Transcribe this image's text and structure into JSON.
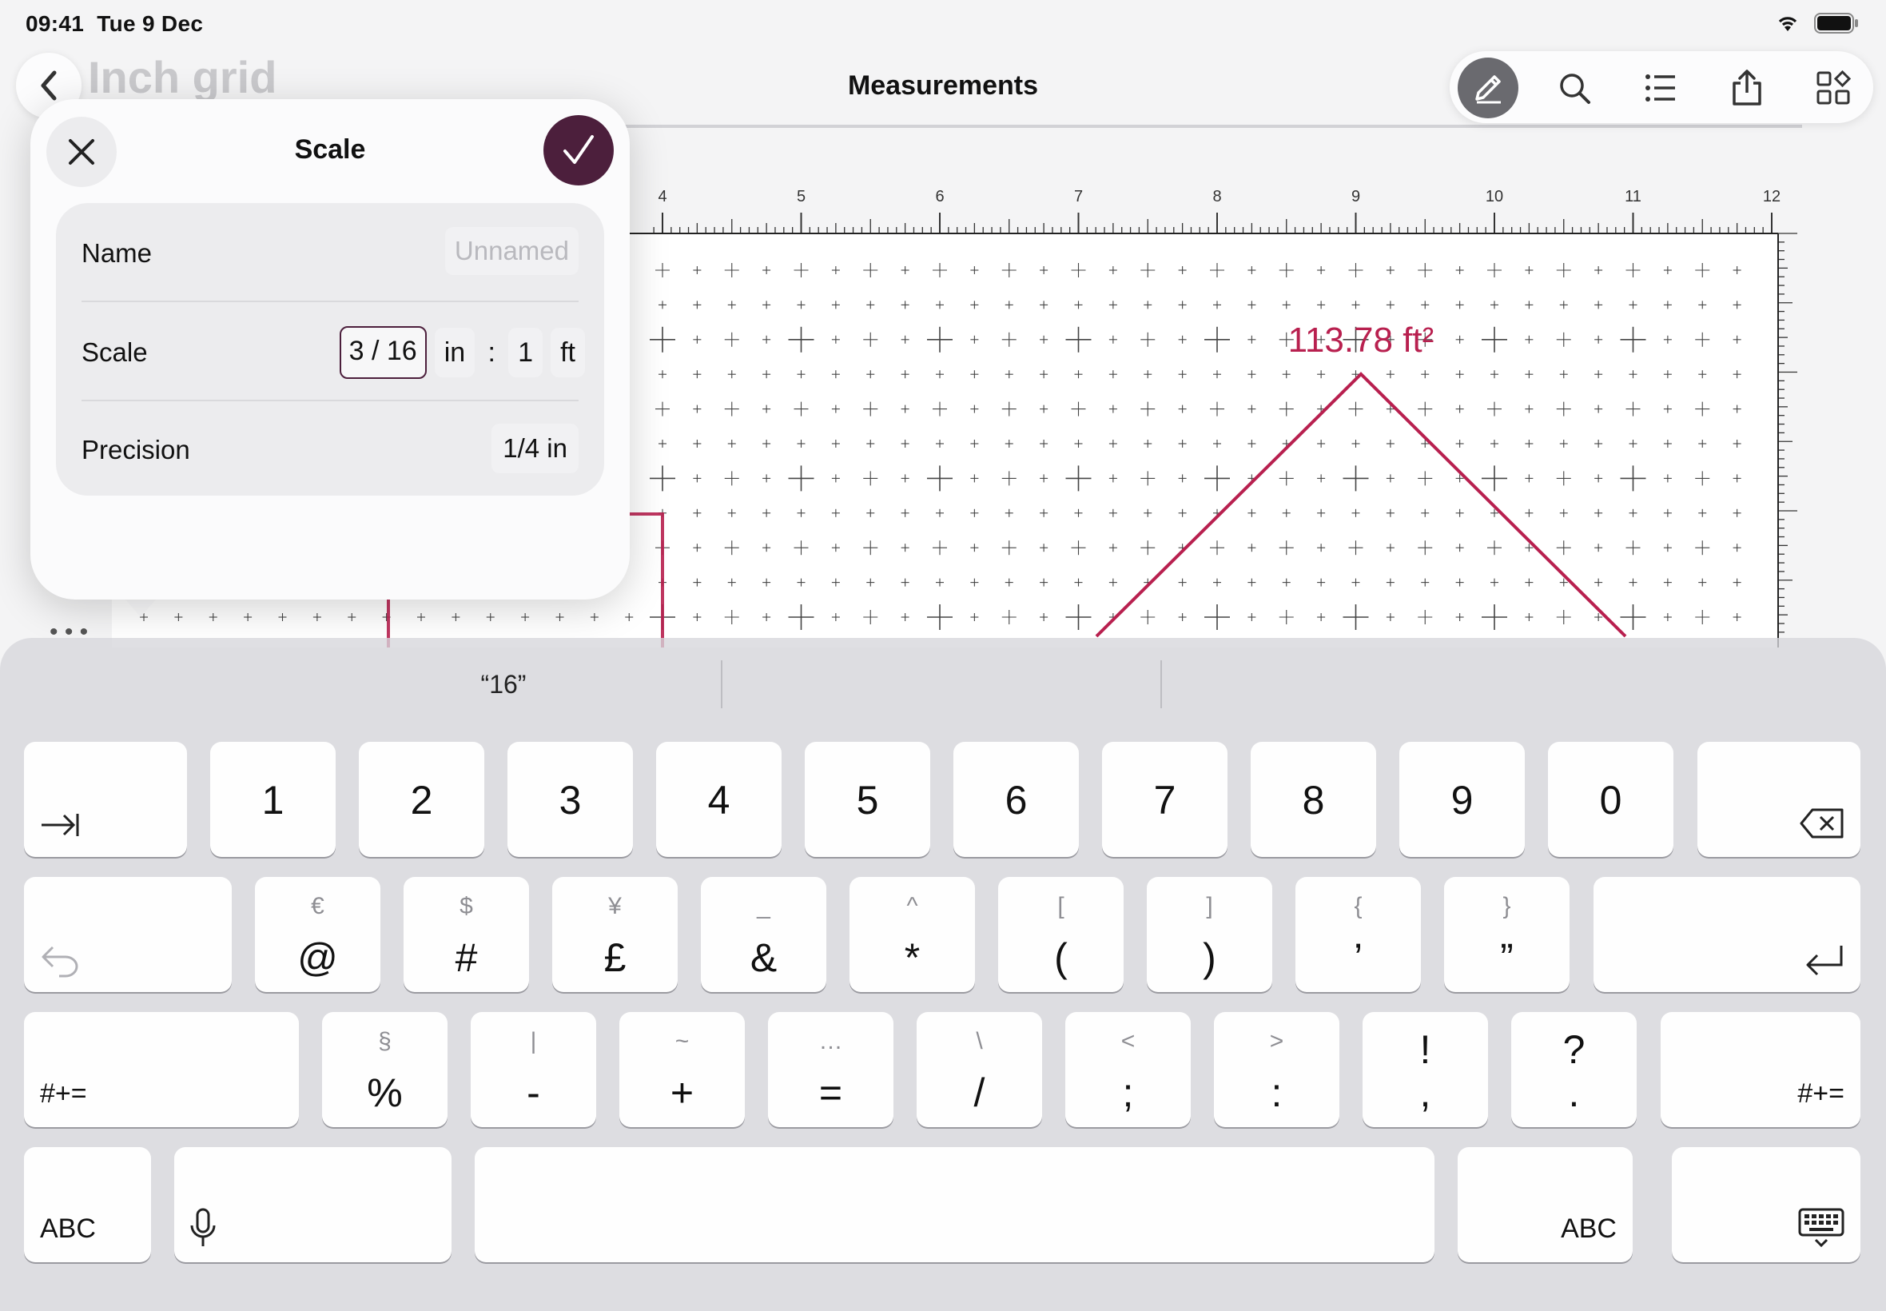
{
  "status_bar": {
    "time": "09:41",
    "date": "Tue 9 Dec"
  },
  "nav": {
    "ghost_title": "Inch grid",
    "title": "Measurements",
    "toolbar_icons": [
      "pencil-icon",
      "search-icon",
      "list-icon",
      "share-icon",
      "grid-apps-icon"
    ]
  },
  "canvas": {
    "ruler_labels": [
      "4",
      "5",
      "6",
      "7",
      "8",
      "9",
      "10",
      "11",
      "12"
    ],
    "area_label": "113.78 ft²",
    "accent": "#b8204f"
  },
  "popover": {
    "title": "Scale",
    "name_label": "Name",
    "name_placeholder": "Unnamed",
    "scale_label": "Scale",
    "scale_value": "3 / 16",
    "scale_unit_left": "in",
    "scale_separator": ":",
    "scale_right_value": "1",
    "scale_unit_right": "ft",
    "precision_label": "Precision",
    "precision_value": "1/4 in",
    "confirm_color": "#4c1f3c"
  },
  "keyboard": {
    "suggestion": "“16”",
    "row1": [
      "1",
      "2",
      "3",
      "4",
      "5",
      "6",
      "7",
      "8",
      "9",
      "0"
    ],
    "row2": [
      {
        "main": "@",
        "sec": "€"
      },
      {
        "main": "#",
        "sec": "$"
      },
      {
        "main": "£",
        "sec": "¥"
      },
      {
        "main": "&",
        "sec": "_"
      },
      {
        "main": "*",
        "sec": "^"
      },
      {
        "main": "(",
        "sec": "["
      },
      {
        "main": ")",
        "sec": "]"
      },
      {
        "main": "’",
        "sec": "{"
      },
      {
        "main": "”",
        "sec": "}"
      }
    ],
    "row3": [
      {
        "main": "%",
        "sec": "§"
      },
      {
        "main": "-",
        "sec": "|"
      },
      {
        "main": "+",
        "sec": "~"
      },
      {
        "main": "=",
        "sec": "…"
      },
      {
        "main": "/",
        "sec": "\\"
      },
      {
        "main": ";",
        "sec": "<"
      },
      {
        "main": ":",
        "sec": ">"
      },
      {
        "main": ",",
        "sec": "!"
      },
      {
        "main": ".",
        "sec": "?"
      }
    ],
    "more_symbols_left": "#+=",
    "more_symbols_right": "#+=",
    "abc_left": "ABC",
    "abc_right": "ABC"
  }
}
